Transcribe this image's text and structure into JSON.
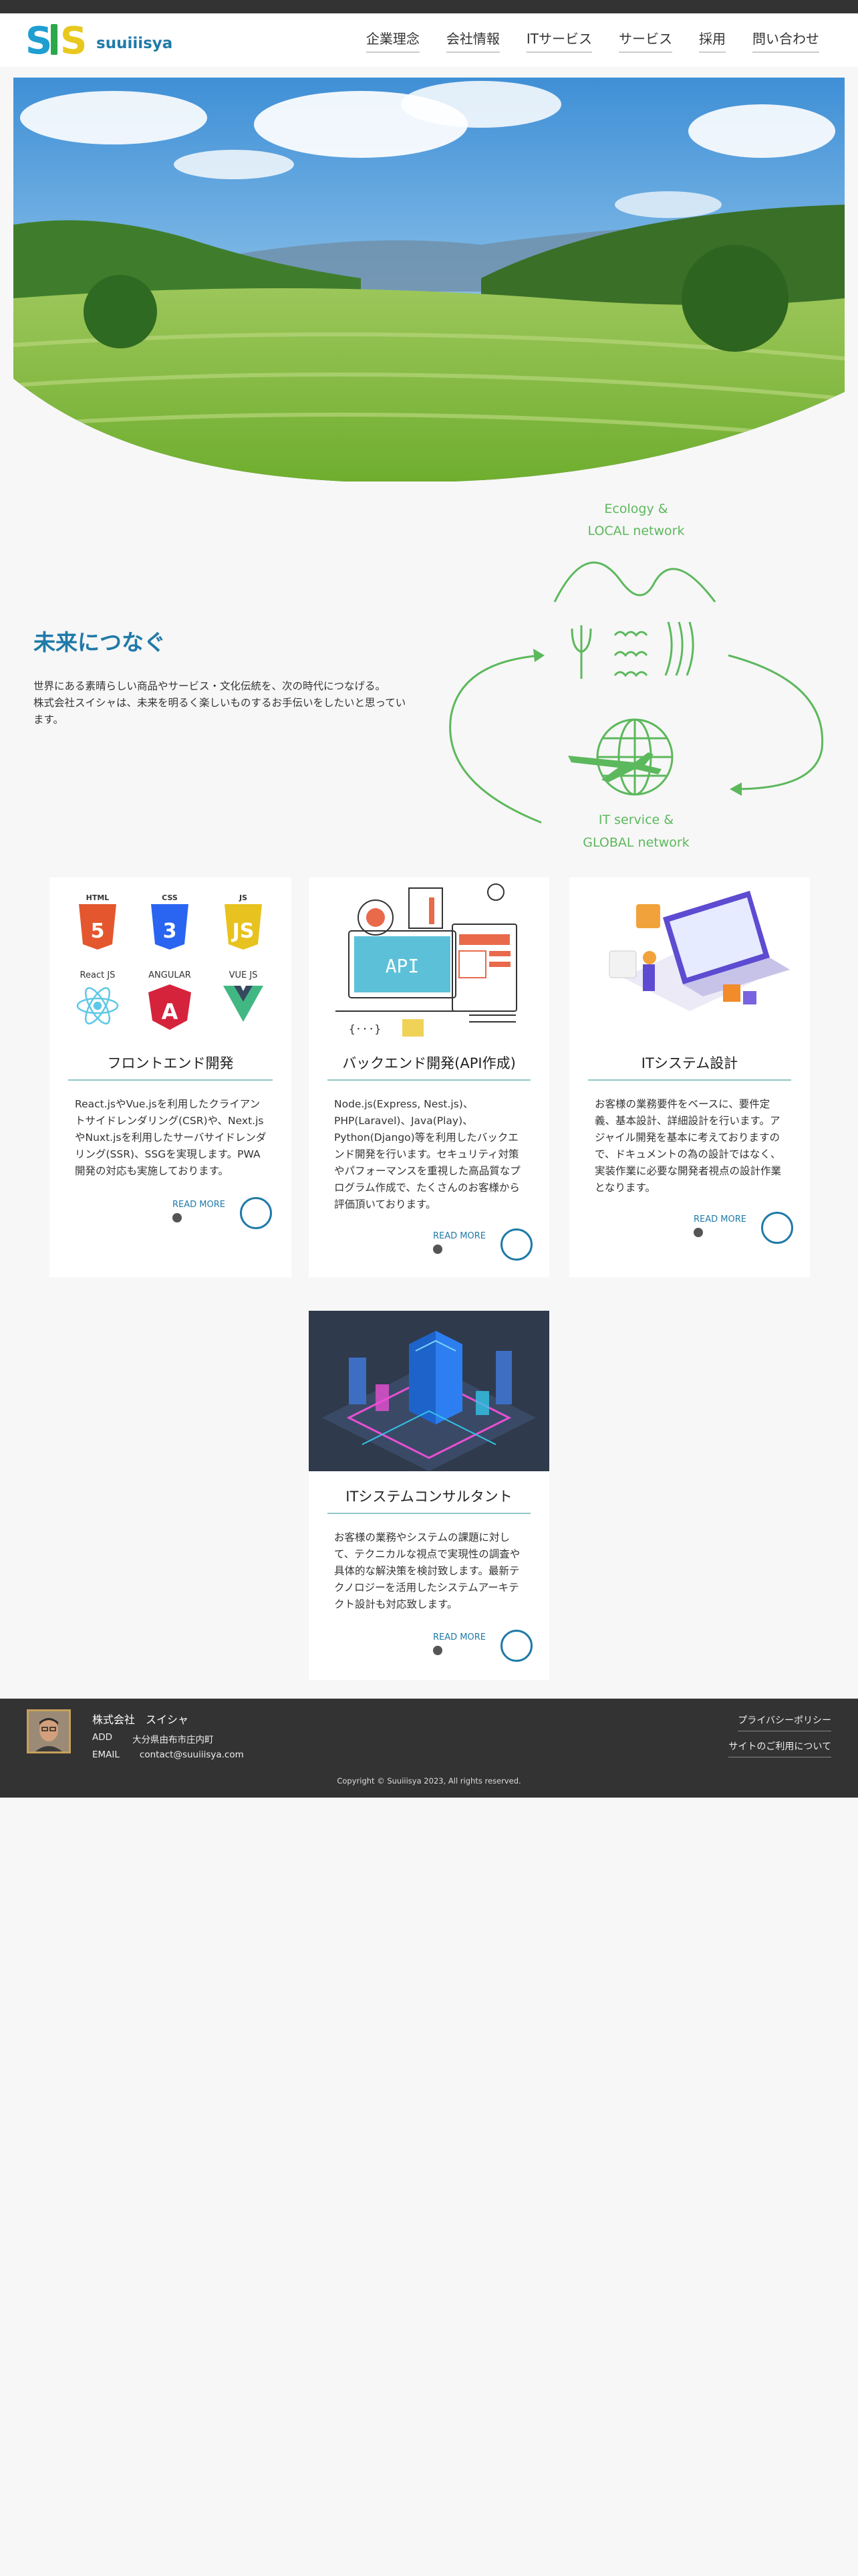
{
  "header": {
    "logo_mark": "SIS",
    "logo_word": "suuiiisya",
    "nav": [
      "企業理念",
      "会社情報",
      "ITサービス",
      "サービス",
      "採用",
      "問い合わせ"
    ]
  },
  "hero": {
    "image": "landscape-terraced-rice-fields"
  },
  "intro": {
    "title": "未来につなぐ",
    "text": "世界にある素晴らしい商品やサービス・文化伝統を、次の時代につなげる。\n株式会社スイシャは、未来を明るく楽しいものするお手伝いをしたいと思っています。"
  },
  "eco_diagram": {
    "top_line1": "Ecology &",
    "top_line2": "LOCAL network",
    "bottom_line1": "IT service &",
    "bottom_line2": "GLOBAL network",
    "color": "#5cb85c"
  },
  "tech_labels": {
    "html": "HTML",
    "css": "CSS",
    "js": "JS",
    "react": "React JS",
    "angular": "ANGULAR",
    "vue": "VUE JS",
    "api": "API"
  },
  "cards": [
    {
      "title": "フロントエンド開発",
      "text": "React.jsやVue.jsを利用したクライアントサイドレンダリング(CSR)や、Next.jsやNuxt.jsを利用したサーバサイドレンダリング(SSR)、SSGを実現します。PWA開発の対応も実施しております。",
      "more": "READ MORE"
    },
    {
      "title": "バックエンド開発(API作成)",
      "text": "Node.js(Express, Nest.js)、PHP(Laravel)、Java(Play)、Python(Django)等を利用したバックエンド開発を行います。セキュリティ対策やパフォーマンスを重視した高品質なプログラム作成で、たくさんのお客様から評価頂いております。",
      "more": "READ MORE"
    },
    {
      "title": "ITシステム設計",
      "text": "お客様の業務要件をベースに、要件定義、基本設計、詳細設計を行います。アジャイル開発を基本に考えておりますので、ドキュメントの為の設計ではなく、実装作業に必要な開発者視点の設計作業となります。",
      "more": "READ MORE"
    },
    {
      "title": "ITシステムコンサルタント",
      "text": "お客様の業務やシステムの課題に対して、テクニカルな視点で実現性の調査や具体的な解決策を検討致します。最新テクノロジーを活用したシステムアーキテクト設計も対応致します。",
      "more": "READ MORE"
    }
  ],
  "footer": {
    "company": "株式会社　スイシャ",
    "add_label": "ADD",
    "address": "大分県由布市庄内町",
    "email_label": "EMAIL",
    "email": "contact@suuiiisya.com",
    "links": [
      "プライバシーポリシー",
      "サイトのご利用について"
    ],
    "copyright": "Copyright © Suuiiisya 2023, All rights reserved."
  },
  "colors": {
    "accent": "#1f7aa8",
    "green": "#5cb85c",
    "footer_bg": "#333333",
    "divider": "#8fc7c4"
  }
}
